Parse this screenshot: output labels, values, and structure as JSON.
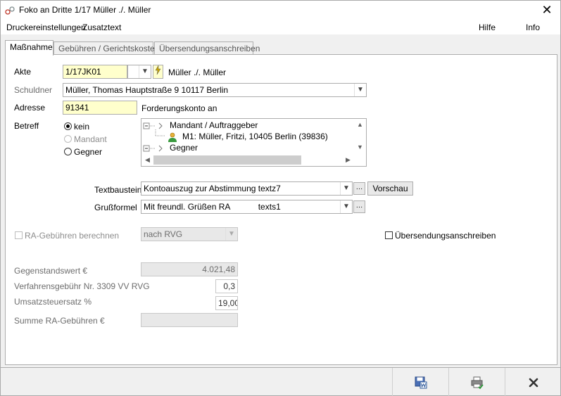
{
  "window": {
    "title": "Foko an Dritte  1/17 Müller ./. Müller"
  },
  "menu": {
    "druckereinstellungen": "Druckereinstellungen",
    "zusatztext": "Zusatztext",
    "hilfe": "Hilfe",
    "info": "Info"
  },
  "tabs": [
    {
      "label": "Maßnahme",
      "active": true
    },
    {
      "label": "Gebühren / Gerichtskosten",
      "active": false
    },
    {
      "label": "Übersendungsanschreiben",
      "active": false
    }
  ],
  "form": {
    "akte_label": "Akte",
    "akte_value": "1/17JK01",
    "akte_name": "Müller ./. Müller",
    "schuldner_label": "Schuldner",
    "schuldner_value": "Müller, Thomas  Hauptstraße 9 10117 Berlin",
    "adresse_label": "Adresse",
    "adresse_value": "91341",
    "adresse_note": "Forderungskonto an",
    "betreff_label": "Betreff",
    "betreff_options": [
      {
        "label": "kein",
        "selected": true,
        "enabled": true
      },
      {
        "label": "Mandant",
        "selected": false,
        "enabled": false
      },
      {
        "label": "Gegner",
        "selected": false,
        "enabled": true
      }
    ],
    "tree": [
      {
        "label": "Mandant / Auftraggeber",
        "level": 0
      },
      {
        "label": "M1: Müller, Fritzi, 10405 Berlin (39836)",
        "level": 1
      },
      {
        "label": "Gegner",
        "level": 0
      }
    ],
    "textbaustein_label": "Textbaustein",
    "textbaustein_value": "Kontoauszug zur Abstimmung  textz7",
    "vorschau_label": "Vorschau",
    "grussformel_label": "Grußformel",
    "grussformel_value": "Mit freundl. Grüßen RA            texts1",
    "ra_gebuehren_label": "RA-Gebühren berechnen",
    "rvg_value": "nach RVG",
    "uebersendung_label": "Übersendungsanschreiben",
    "gegenstandswert_label": "Gegenstandswert €",
    "gegenstandswert_value": "4.021,48",
    "verfahrensgebuehr_label": "Verfahrensgebühr Nr. 3309 VV RVG",
    "verfahrensgebuehr_value": "0,3",
    "umsatzsteuer_label": "Umsatzsteuersatz %",
    "umsatzsteuer_value": "19,00",
    "summe_label": "Summe RA-Gebühren €",
    "summe_value": ""
  },
  "icons": {
    "app": "app-icon",
    "close": "close-icon",
    "save_word": "save-word-icon",
    "print": "print-icon",
    "cancel": "cancel-icon"
  },
  "colors": {
    "yellow_field": "#ffffcc",
    "cancel_x": "#333333",
    "check_green": "#2e9d3a"
  }
}
